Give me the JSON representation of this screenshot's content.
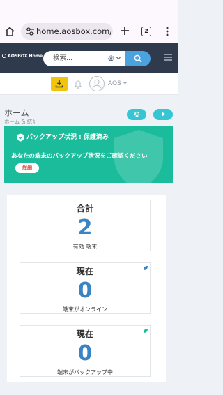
{
  "browser": {
    "url": "home.aosbox.com/Dash",
    "tab_count": "2"
  },
  "header": {
    "logo_text": "AOSBOX Home",
    "search_placeholder": "検索..."
  },
  "toolbar": {
    "user_name": "AOS"
  },
  "page": {
    "title": "ホーム",
    "breadcrumb": "ホーム & 統計"
  },
  "banner": {
    "status": "バックアップ状況 : 保護済み",
    "message": "あなたの端末のバックアップ状況をご確認ください",
    "details_label": "詳細"
  },
  "stats": [
    {
      "title": "合計",
      "value": "2",
      "label": "有効 端末"
    },
    {
      "title": "現在",
      "value": "0",
      "label": "端末がオンライン",
      "dot_color": "#3b84c4"
    },
    {
      "title": "現在",
      "value": "0",
      "label": "端末がバックアップ中",
      "dot_color": "#1bbc9b"
    }
  ],
  "colors": {
    "header_bg": "#2f3a4c",
    "accent_blue": "#4aa3df",
    "banner_green": "#1bbc9b",
    "stat_blue": "#3b84c4",
    "download_yellow": "#f1c40f",
    "action_cyan": "#36c6d3"
  },
  "icons": {
    "browser": [
      "home-icon",
      "tune-icon",
      "plus-icon",
      "tabs-icon",
      "more-vertical-icon"
    ],
    "header": [
      "gear-icon",
      "chevron-down-icon",
      "search-icon",
      "hamburger-icon"
    ],
    "toolbar": [
      "download-icon",
      "bell-icon",
      "avatar-icon",
      "chevron-down-icon"
    ],
    "actions": [
      "gear-icon",
      "play-icon"
    ],
    "banner": [
      "shield-check-icon"
    ]
  }
}
